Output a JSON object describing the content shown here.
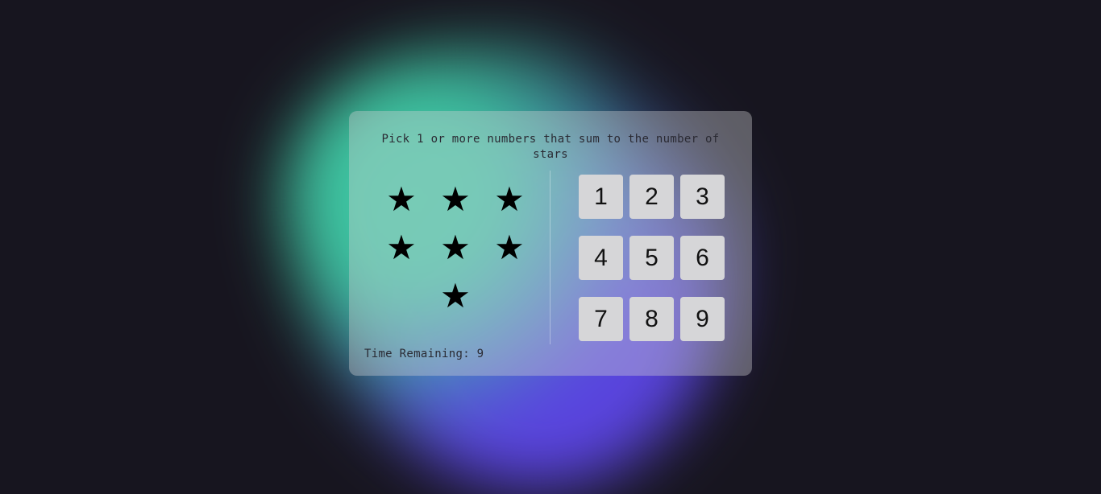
{
  "game": {
    "help_text": "Pick 1 or more numbers that sum to the number of stars",
    "star_glyph": "★",
    "star_count": 7,
    "numbers": [
      "1",
      "2",
      "3",
      "4",
      "5",
      "6",
      "7",
      "8",
      "9"
    ],
    "timer_label": "Time Remaining: 9"
  },
  "colors": {
    "background": "#17151f",
    "blob_green": "#3fc9a4",
    "blob_purple": "#5a44e0",
    "number_button": "#d6d6d8"
  }
}
